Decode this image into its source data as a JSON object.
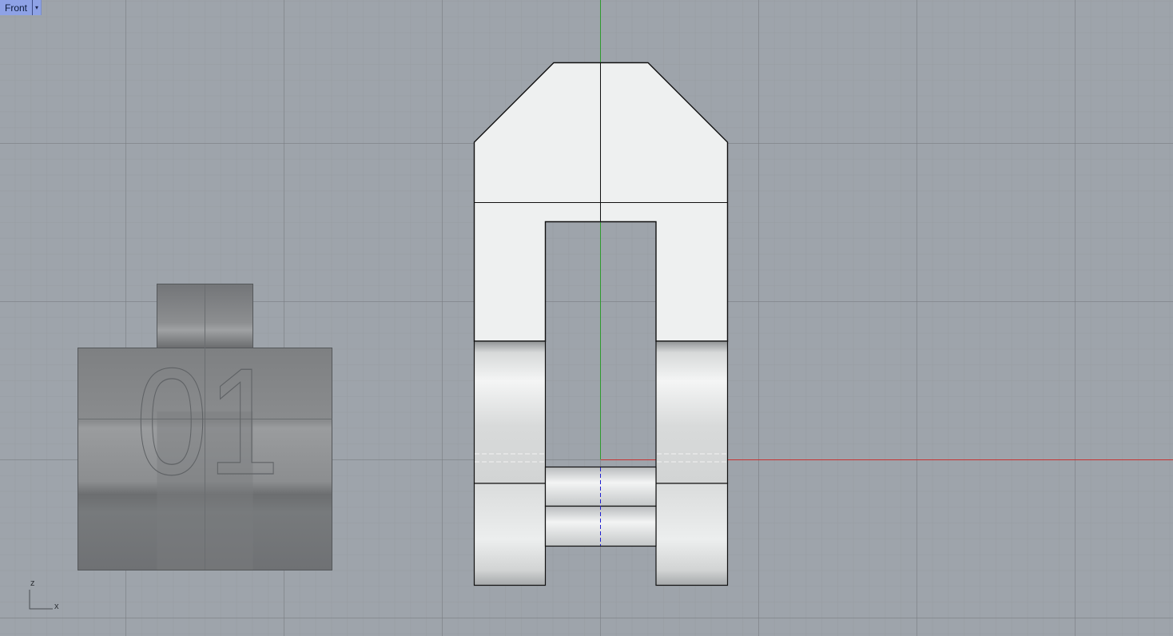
{
  "viewport": {
    "name": "Front",
    "dropdown_glyph": "▾"
  },
  "axes_icon": {
    "vertical": "z",
    "horizontal": "x"
  },
  "engraving": {
    "text": "01"
  },
  "colors": {
    "background": "#9ea4ab",
    "x_axis": "#c83232",
    "z_axis": "#2e9a2e",
    "y_axis": "#1f1fcf",
    "part_fill": "#eef0f0",
    "ghost_fill": "#7a7c7f"
  }
}
